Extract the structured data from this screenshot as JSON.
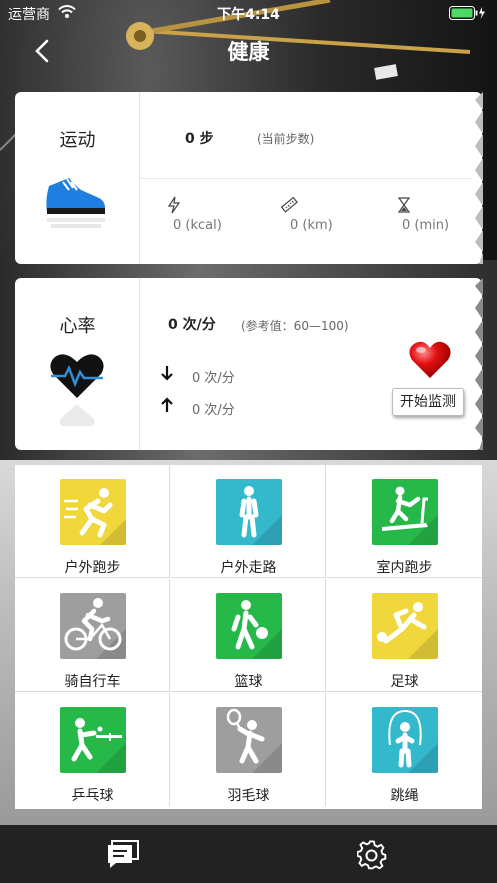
{
  "status_bar": {
    "carrier": "运营商",
    "time": "下午4:14"
  },
  "nav": {
    "title": "健康"
  },
  "sport_card": {
    "title": "运动",
    "steps_value": "0 步",
    "steps_note": "(当前步数)",
    "metrics": [
      {
        "icon": "lightning-icon",
        "value": "0 (kcal)"
      },
      {
        "icon": "ruler-icon",
        "value": "0 (km)"
      },
      {
        "icon": "hourglass-icon",
        "value": "0 (min)"
      }
    ]
  },
  "heart_card": {
    "title": "心率",
    "rate_value": "0 次/分",
    "reference": "(参考值：60—100)",
    "low_value": "0 次/分",
    "high_value": "0 次/分",
    "monitor_label": "开始监测"
  },
  "sports_grid": [
    {
      "label": "户外跑步",
      "color": "#f0d73c",
      "icon": "running-icon"
    },
    {
      "label": "户外走路",
      "color": "#34b8cc",
      "icon": "walking-icon"
    },
    {
      "label": "室内跑步",
      "color": "#27b84a",
      "icon": "treadmill-icon"
    },
    {
      "label": "骑自行车",
      "color": "#9e9e9e",
      "icon": "cycling-icon"
    },
    {
      "label": "篮球",
      "color": "#27b84a",
      "icon": "basketball-icon"
    },
    {
      "label": "足球",
      "color": "#f0d73c",
      "icon": "football-icon"
    },
    {
      "label": "乒乓球",
      "color": "#27b84a",
      "icon": "table-tennis-icon"
    },
    {
      "label": "羽毛球",
      "color": "#9e9e9e",
      "icon": "badminton-icon"
    },
    {
      "label": "跳绳",
      "color": "#34b8cc",
      "icon": "jump-rope-icon"
    }
  ],
  "tabbar": {
    "items": [
      {
        "icon": "message-icon"
      },
      {
        "icon": "settings-gear-icon"
      }
    ]
  }
}
